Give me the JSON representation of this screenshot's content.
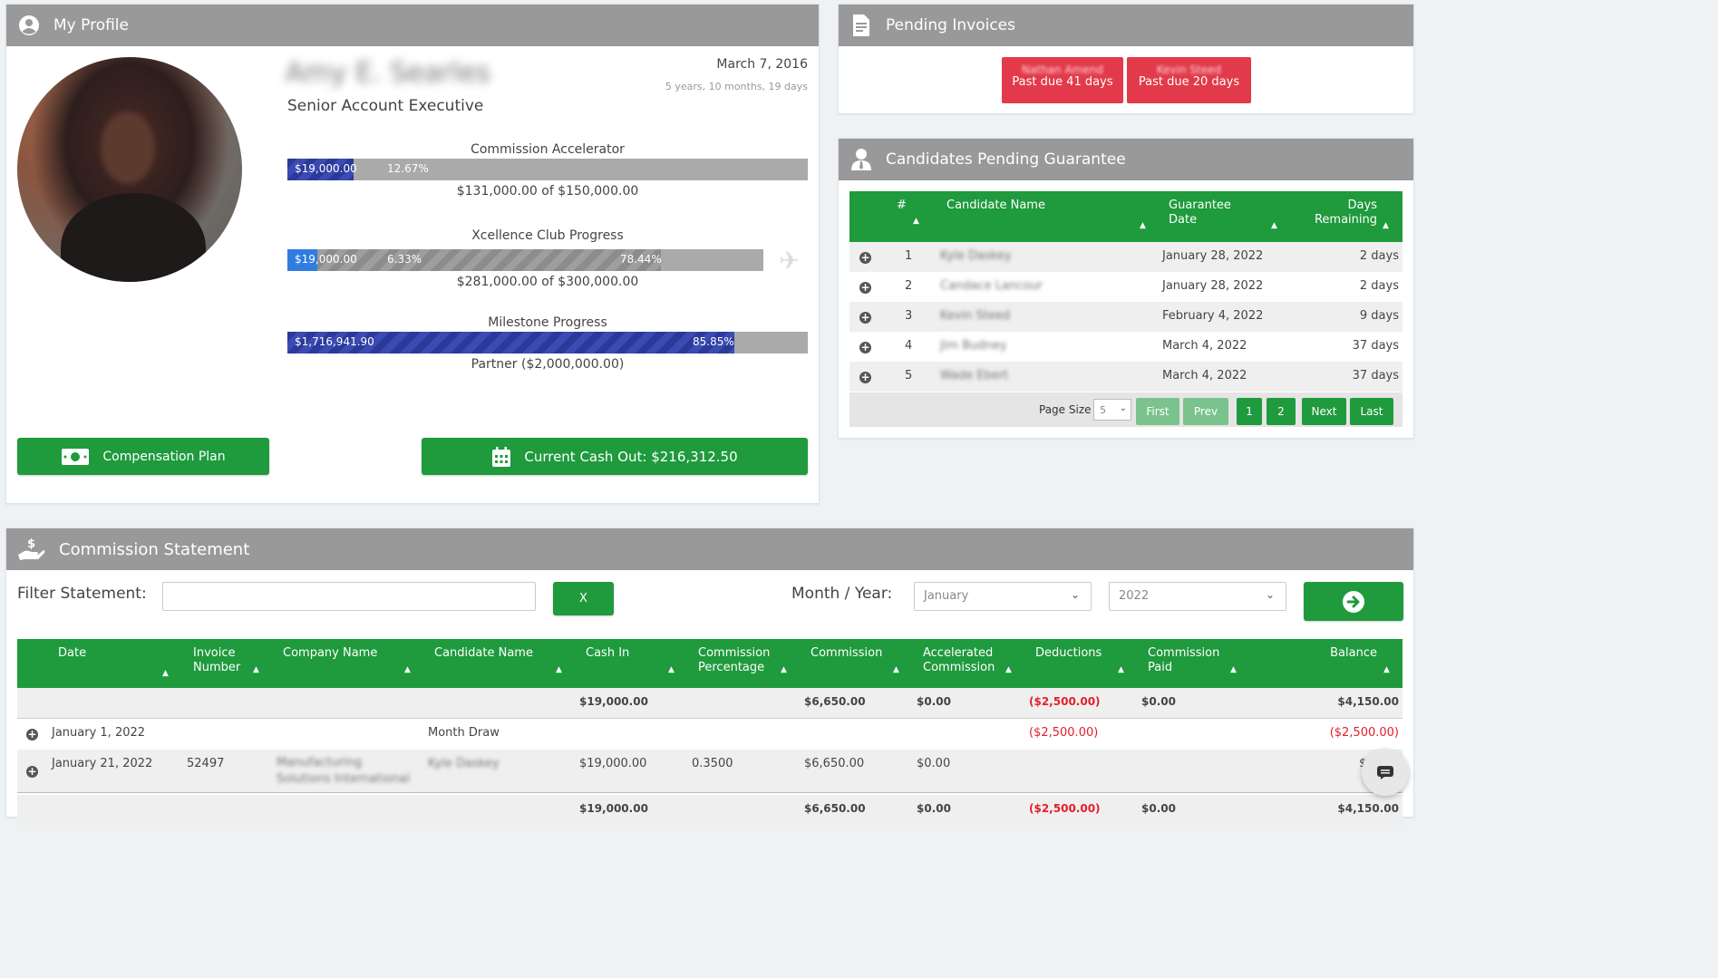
{
  "profile": {
    "title": "My Profile",
    "name": "Amy E. Searles",
    "job_title": "Senior Account Executive",
    "hire_date": "March 7, 2016",
    "tenure": "5 years, 10 months, 19 days",
    "commission_accelerator": {
      "title": "Commission Accelerator",
      "amount_label": "$19,000.00",
      "pct_label": "12.67%",
      "fill": 0.1267,
      "subtitle": "$131,000.00 of $150,000.00"
    },
    "xcellence": {
      "title": "Xcellence Club Progress",
      "amount_label": "$19,000.00",
      "pct_label": "6.33%",
      "pct2_label": "78.44%",
      "fill_blue": 0.0633,
      "fill_grey": 0.7844,
      "subtitle": "$281,000.00 of $300,000.00"
    },
    "milestone": {
      "title": "Milestone Progress",
      "amount_label": "$1,716,941.90",
      "pct_label": "85.85%",
      "fill": 0.8585,
      "subtitle": "Partner ($2,000,000.00)"
    },
    "comp_plan_label": "Compensation Plan",
    "cash_out_label": "Current Cash Out: $216,312.50"
  },
  "invoices": {
    "title": "Pending Invoices",
    "items": [
      {
        "name": "Nathan Amend",
        "due": "Past due 41 days"
      },
      {
        "name": "Kevin Steed",
        "due": "Past due 20 days"
      }
    ]
  },
  "candidates": {
    "title": "Candidates Pending Guarantee",
    "headers": {
      "num": "#",
      "name": "Candidate Name",
      "date_1": "Guarantee",
      "date_2": "Date",
      "days_1": "Days",
      "days_2": "Remaining"
    },
    "rows": [
      {
        "num": "1",
        "name": "Kyle Daskey",
        "date": "January 28, 2022",
        "days": "2 days"
      },
      {
        "num": "2",
        "name": "Candace Lancour",
        "date": "January 28, 2022",
        "days": "2 days"
      },
      {
        "num": "3",
        "name": "Kevin Steed",
        "date": "February 4, 2022",
        "days": "9 days"
      },
      {
        "num": "4",
        "name": "Jim Budney",
        "date": "March 4, 2022",
        "days": "37 days"
      },
      {
        "num": "5",
        "name": "Wade Ebert",
        "date": "March 4, 2022",
        "days": "37 days"
      }
    ],
    "pager": {
      "size_label": "Page Size",
      "size_value": "5",
      "first": "First",
      "prev": "Prev",
      "p1": "1",
      "p2": "2",
      "next": "Next",
      "last": "Last"
    }
  },
  "commission": {
    "title": "Commission Statement",
    "filter_label": "Filter Statement:",
    "filter_value": "",
    "clear_label": "X",
    "month_year_label": "Month / Year:",
    "month_value": "January",
    "year_value": "2022",
    "headers": {
      "date": "Date",
      "invoice_1": "Invoice",
      "invoice_2": "Number",
      "company": "Company Name",
      "candidate": "Candidate Name",
      "cash_in": "Cash In",
      "pct_1": "Commission",
      "pct_2": "Percentage",
      "commission": "Commission",
      "accel_1": "Accelerated",
      "accel_2": "Commission",
      "deductions": "Deductions",
      "paid_1": "Commission",
      "paid_2": "Paid",
      "balance": "Balance"
    },
    "summary": {
      "cash_in": "$19,000.00",
      "commission": "$6,650.00",
      "accel": "$0.00",
      "deductions": "($2,500.00)",
      "paid": "$0.00",
      "balance": "$4,150.00"
    },
    "rows": [
      {
        "date": "January 1, 2022",
        "invoice": "",
        "company": "",
        "candidate": "Month Draw",
        "cash_in": "",
        "pct": "",
        "commission": "",
        "accel": "",
        "deductions": "($2,500.00)",
        "paid": "",
        "balance": "($2,500.00)"
      },
      {
        "date": "January 21, 2022",
        "invoice": "52497",
        "company_1": "Manufacturing",
        "company_2": "Solutions International",
        "candidate": "Kyle Daskey",
        "cash_in": "$19,000.00",
        "pct": "0.3500",
        "commission": "$6,650.00",
        "accel": "$0.00",
        "deductions": "",
        "paid": "",
        "balance": "$4,1"
      }
    ],
    "footer": {
      "cash_in": "$19,000.00",
      "commission": "$6,650.00",
      "accel": "$0.00",
      "deductions": "($2,500.00)",
      "paid": "$0.00",
      "balance": "$4,150.00"
    }
  }
}
